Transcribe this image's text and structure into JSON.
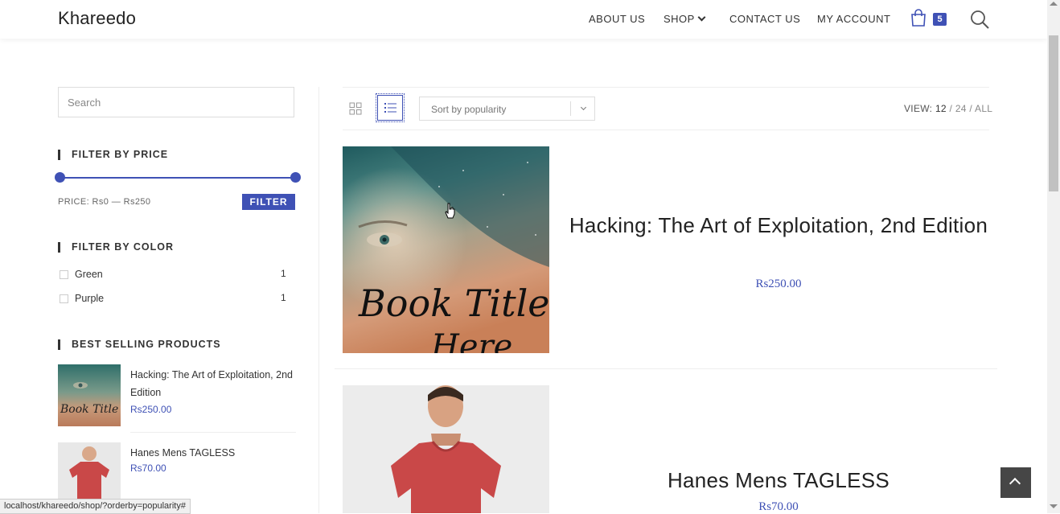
{
  "site": {
    "logo": "Khareedo",
    "nav": {
      "about": "ABOUT US",
      "shop": "SHOP",
      "contact": "CONTACT US",
      "account": "MY ACCOUNT"
    },
    "cart_count": "5",
    "accent_color": "#3f51b5"
  },
  "sidebar": {
    "search_placeholder": "Search",
    "price_filter": {
      "title": "FILTER BY PRICE",
      "range_text": "PRICE: Rs0 — Rs250",
      "button": "FILTER",
      "min_fraction": 0,
      "max_fraction": 1
    },
    "color_filter": {
      "title": "FILTER BY COLOR",
      "items": [
        {
          "label": "Green",
          "count": "1"
        },
        {
          "label": "Purple",
          "count": "1"
        }
      ]
    },
    "best_selling": {
      "title": "BEST SELLING PRODUCTS",
      "items": [
        {
          "title": "Hacking: The Art of Exploitation, 2nd Edition",
          "price": "Rs250.00",
          "thumb_text": "Book Title Here"
        },
        {
          "title": "Hanes Mens TAGLESS",
          "price": "Rs70.00"
        }
      ]
    }
  },
  "toolbar": {
    "sort_selected": "Sort by popularity",
    "view_label": "VIEW:",
    "view_options": [
      "12",
      "24",
      "ALL"
    ]
  },
  "products": [
    {
      "title": "Hacking: The Art of Exploitation, 2nd Edition",
      "price": "Rs250.00",
      "cover_text_1": "Book Title",
      "cover_text_2": "Here"
    },
    {
      "title": "Hanes Mens TAGLESS",
      "price": "Rs70.00"
    }
  ],
  "status_bar": "localhost/khareedo/shop/?orderby=popularity#"
}
